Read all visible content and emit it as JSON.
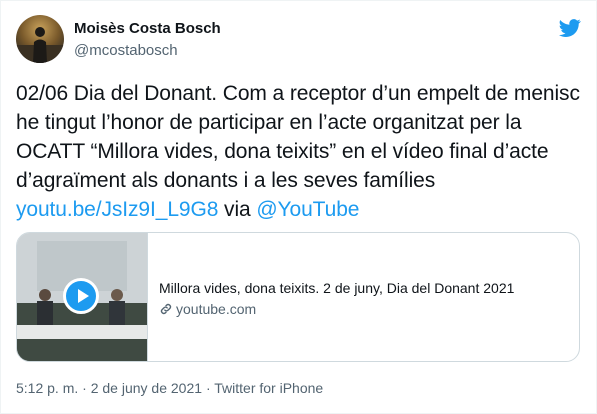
{
  "user": {
    "display_name": "Moisès Costa Bosch",
    "handle": "@mcostabosch"
  },
  "tweet": {
    "text_parts": [
      "02/06 Dia del Donant. Com a receptor d’un empelt de menisc he tingut l’honor de participar en l’acte organitzat per la OCATT “Millora vides, dona teixits” en el vídeo final d’acte d’agraïment als donants i a les seves famílies ",
      " via "
    ],
    "link_url_text": "youtu.be/JsIz9I_L9G8",
    "mention_text": "@YouTube"
  },
  "card": {
    "title": "Millora vides, dona teixits. 2 de juny, Dia del Donant 2021",
    "domain": "youtube.com"
  },
  "meta": {
    "time": "5:12 p. m.",
    "separator": "·",
    "date": "2 de juny de 2021",
    "source": "Twitter for iPhone"
  },
  "colors": {
    "link": "#1d9bf0",
    "secondary_text": "#536471",
    "primary_text": "#0f1419",
    "card_border": "#cfd9de"
  },
  "icons": [
    "twitter-bird-icon",
    "play-icon",
    "link-icon"
  ]
}
